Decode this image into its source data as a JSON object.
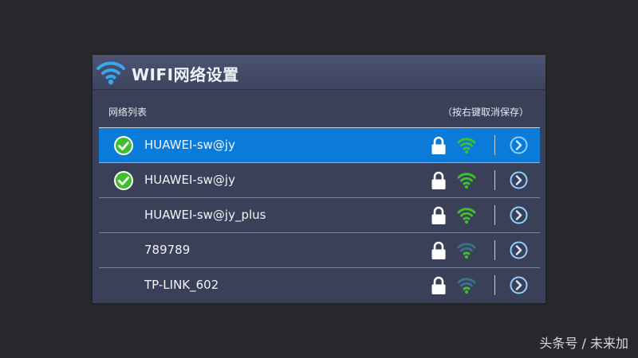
{
  "header": {
    "title": "WIFI网络设置",
    "icon": "wifi-icon"
  },
  "subheader": {
    "list_label": "网络列表",
    "hint": "（按右键取消保存）"
  },
  "networks": [
    {
      "name": "HUAWEI-sw@jy",
      "saved": true,
      "selected": true,
      "secured": true,
      "signal_strength": "strong"
    },
    {
      "name": "HUAWEI-sw@jy",
      "saved": true,
      "selected": false,
      "secured": true,
      "signal_strength": "strong"
    },
    {
      "name": "HUAWEI-sw@jy_plus",
      "saved": false,
      "selected": false,
      "secured": true,
      "signal_strength": "strong"
    },
    {
      "name": "789789",
      "saved": false,
      "selected": false,
      "secured": true,
      "signal_strength": "weak"
    },
    {
      "name": "TP-LINK_602",
      "saved": false,
      "selected": false,
      "secured": true,
      "signal_strength": "weak"
    }
  ],
  "watermark": "头条号 / 未来加",
  "colors": {
    "accent": "#0b7bd9",
    "panel": "#3a4058",
    "signal_active": "#3fbf2c",
    "signal_inactive": "#3b6f8a",
    "check": "#3fbf2c"
  }
}
